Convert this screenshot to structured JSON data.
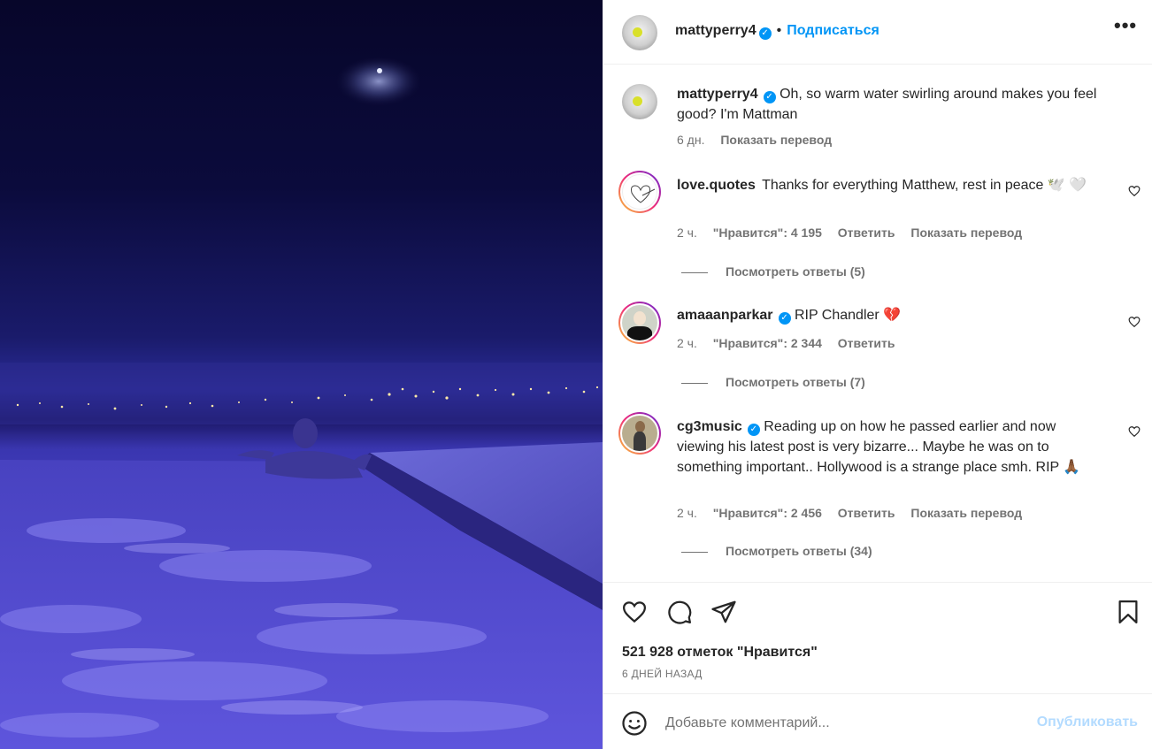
{
  "post": {
    "author": "mattyperry4",
    "follow_label": "Подписаться",
    "separator": "•",
    "caption": "Oh, so warm water swirling around makes you feel good? I'm Mattman",
    "caption_time": "6 дн.",
    "caption_translate": "Показать перевод"
  },
  "comments": [
    {
      "user": "love.quotes",
      "verified": false,
      "text": "Thanks for everything Matthew, rest in peace 🕊️ 🤍",
      "time": "2 ч.",
      "likes": "\"Нравится\": 4 195",
      "reply": "Ответить",
      "translate": "Показать перевод",
      "view_replies": "Посмотреть ответы (5)"
    },
    {
      "user": "amaaanparkar",
      "verified": true,
      "text": "RIP Chandler 💔",
      "time": "2 ч.",
      "likes": "\"Нравится\": 2 344",
      "reply": "Ответить",
      "view_replies": "Посмотреть ответы (7)"
    },
    {
      "user": "cg3music",
      "verified": true,
      "text": "Reading up on how he passed earlier and now viewing his latest post is very bizarre... Maybe he was on to something important.. Hollywood is a strange place smh. RIP 🙏🏾",
      "time": "2 ч.",
      "likes": "\"Нравится\": 2 456",
      "reply": "Ответить",
      "translate": "Показать перевод",
      "view_replies": "Посмотреть ответы (34)"
    }
  ],
  "actions": {
    "like_icon": "heart-icon",
    "comment_icon": "comment-icon",
    "share_icon": "paper-plane-icon",
    "save_icon": "bookmark-icon",
    "likes_count": "521 928 отметок \"Нравится\"",
    "date": "6 ДНЕЙ НАЗАД"
  },
  "composer": {
    "placeholder": "Добавьте комментарий...",
    "publish_label": "Опубликовать",
    "emoji_icon": "smiley-icon"
  },
  "colors": {
    "accent": "#0095f6",
    "publish_disabled": "#b3dbff",
    "muted": "#737373",
    "text": "#262626"
  }
}
